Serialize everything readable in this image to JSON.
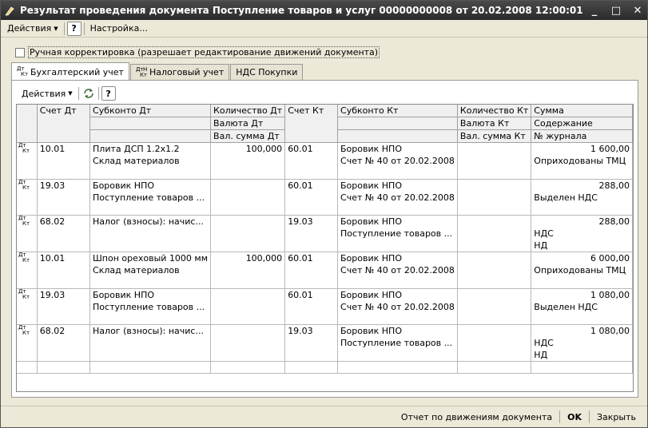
{
  "window": {
    "title": "Результат проведения документа Поступление товаров и услуг 00000000008 от 20.02.2008 12:00:01",
    "minimize": "_",
    "maximize": "□",
    "close": "✕"
  },
  "menu": {
    "actions": "Действия",
    "help": "?",
    "settings": "Настройка..."
  },
  "manual": {
    "label": "Ручная корректировка (разрешает редактирование движений документа)"
  },
  "tabs": [
    {
      "label": "Бухгалтерский учет",
      "icon_a": "Дт",
      "icon_b": "Кт"
    },
    {
      "label": "Налоговый учет",
      "icon_a": "Дт",
      "icon_b": "Кт",
      "icon_c": "Н"
    },
    {
      "label": "НДС Покупки"
    }
  ],
  "panel": {
    "actions": "Действия",
    "help": "?"
  },
  "columns": {
    "h1": [
      "Счет Дт",
      "Субконто Дт",
      "Количество Дт",
      "Счет Кт",
      "Субконто Кт",
      "Количество Кт",
      "Сумма"
    ],
    "h2": [
      "Валюта Дт",
      "Валюта Кт",
      "Содержание"
    ],
    "h3": [
      "Вал. сумма Дт",
      "Вал. сумма Кт",
      "№ журнала"
    ]
  },
  "row_icon": {
    "a": "Дт",
    "b": "Кт"
  },
  "rows": [
    {
      "dt": "10.01",
      "sub_dt1": "Плита ДСП 1.2х1.2",
      "sub_dt2": "Склад материалов",
      "qty_dt": "100,000",
      "kt": "60.01",
      "sub_kt1": "Боровик НПО",
      "sub_kt2": "Счет № 40 от 20.02.2008",
      "sum": "1 600,00",
      "content": "Оприходованы ТМЦ",
      "journal": ""
    },
    {
      "dt": "19.03",
      "sub_dt1": "Боровик НПО",
      "sub_dt2": "Поступление товаров ...",
      "qty_dt": "",
      "kt": "60.01",
      "sub_kt1": "Боровик НПО",
      "sub_kt2": "Счет № 40 от 20.02.2008",
      "sum": "288,00",
      "content": "Выделен НДС",
      "journal": ""
    },
    {
      "dt": "68.02",
      "sub_dt1": "Налог (взносы): начис...",
      "sub_dt2": "",
      "qty_dt": "",
      "kt": "19.03",
      "sub_kt1": "Боровик НПО",
      "sub_kt2": "Поступление товаров ...",
      "sum": "288,00",
      "content": "НДС",
      "journal": "НД"
    },
    {
      "dt": "10.01",
      "sub_dt1": "Шпон ореховый 1000 мм",
      "sub_dt2": "Склад материалов",
      "qty_dt": "100,000",
      "kt": "60.01",
      "sub_kt1": "Боровик НПО",
      "sub_kt2": "Счет № 40 от 20.02.2008",
      "sum": "6 000,00",
      "content": "Оприходованы ТМЦ",
      "journal": ""
    },
    {
      "dt": "19.03",
      "sub_dt1": "Боровик НПО",
      "sub_dt2": "Поступление товаров ...",
      "qty_dt": "",
      "kt": "60.01",
      "sub_kt1": "Боровик НПО",
      "sub_kt2": "Счет № 40 от 20.02.2008",
      "sum": "1 080,00",
      "content": "Выделен НДС",
      "journal": ""
    },
    {
      "dt": "68.02",
      "sub_dt1": "Налог (взносы): начис...",
      "sub_dt2": "",
      "qty_dt": "",
      "kt": "19.03",
      "sub_kt1": "Боровик НПО",
      "sub_kt2": "Поступление товаров ...",
      "sum": "1 080,00",
      "content": "НДС",
      "journal": "НД"
    }
  ],
  "status": {
    "report": "Отчет по движениям документа",
    "ok": "OK",
    "close": "Закрыть"
  }
}
